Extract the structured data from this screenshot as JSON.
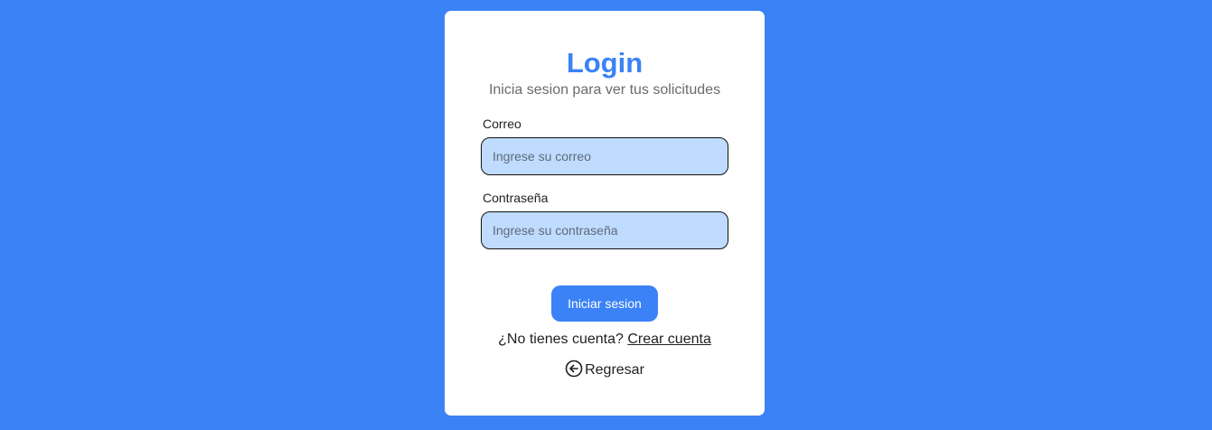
{
  "login": {
    "title": "Login",
    "subtitle": "Inicia sesion para ver tus solicitudes",
    "email": {
      "label": "Correo",
      "placeholder": "Ingrese su correo",
      "value": ""
    },
    "password": {
      "label": "Contraseña",
      "placeholder": "Ingrese su contraseña",
      "value": ""
    },
    "submit_label": "Iniciar sesion",
    "signup_prompt": "¿No tienes cuenta?",
    "signup_link": "Crear cuenta",
    "back_label": "Regresar",
    "back_icon": "arrow-left-circle-icon"
  },
  "colors": {
    "background": "#3b82f6",
    "accent": "#3b82f6",
    "field_fill": "#bfdbfe",
    "card": "#ffffff"
  }
}
